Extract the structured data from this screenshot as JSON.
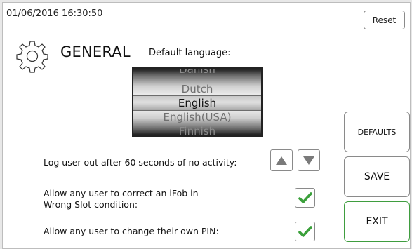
{
  "header": {
    "datetime": "01/06/2016 16:30:50",
    "reset_label": "Reset"
  },
  "page": {
    "title": "GENERAL",
    "icon": "gear-icon"
  },
  "language": {
    "label": "Default language:",
    "options": [
      "Danish",
      "Dutch",
      "English",
      "English(USA)",
      "Finnish"
    ],
    "selected": "English"
  },
  "settings": {
    "timeout_label": "Log user out after 60 seconds of no activity:",
    "wrong_slot_label": "Allow any user to correct an iFob in Wrong Slot condition:",
    "wrong_slot_checked": true,
    "change_pin_label": "Allow any user to change their own PIN:",
    "change_pin_checked": true
  },
  "actions": {
    "defaults_label": "DEFAULTS",
    "save_label": "SAVE",
    "exit_label": "EXIT"
  },
  "colors": {
    "check_green": "#3aa03a",
    "exit_border": "#3f9d3f"
  }
}
